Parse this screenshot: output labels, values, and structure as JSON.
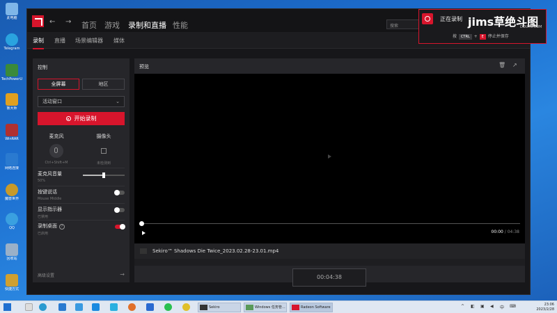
{
  "desktop": {
    "icons": [
      {
        "label": "此电脑",
        "color": "#7fb6e8"
      },
      {
        "label": "Telegram",
        "color": "#2aa3df"
      },
      {
        "label": "TechPowerUp GPU-Z",
        "color": "#3a8a3a"
      },
      {
        "label": "鲁大师",
        "color": "#e0a020"
      },
      {
        "label": "WinRAR",
        "color": "#b03030"
      },
      {
        "label": "网络连接",
        "color": "#2a7ad0"
      },
      {
        "label": "魔兽世界",
        "color": "#c89a2a"
      },
      {
        "label": "QQ",
        "color": "#3aa0e0"
      },
      {
        "label": "回收站",
        "color": "#9ab0c8"
      },
      {
        "label": "快捷方式",
        "color": "#d0a030"
      }
    ]
  },
  "app": {
    "top_tabs": [
      "首页",
      "游戏",
      "录制和直播",
      "性能"
    ],
    "active_top_tab": 2,
    "search_placeholder": "搜索",
    "sub_tabs": [
      "录制",
      "直播",
      "场景编辑器",
      "媒体"
    ],
    "active_sub_tab": 0
  },
  "control": {
    "header": "控制",
    "capture_modes": [
      "全屏幕",
      "地区"
    ],
    "active_mode": 0,
    "source": "活动窗口",
    "record_button": "开始录制",
    "mic": {
      "label": "麦克风",
      "hotkey": "Ctrl+Shift+M"
    },
    "camera": {
      "label": "摄像头",
      "status": "未检测到"
    },
    "mic_volume": {
      "label": "麦克风音量",
      "value": "50%",
      "level": 0.5
    },
    "push_to_talk": {
      "label": "按键说话",
      "sub": "Mouse Middle",
      "on": false
    },
    "show_indicator": {
      "label": "显示指示器",
      "sub": "已禁用",
      "on": false
    },
    "record_desktop": {
      "label": "录制桌面",
      "sub": "已启用",
      "info": "?",
      "on": true
    },
    "advanced": "高级设置"
  },
  "preview": {
    "header": "预览",
    "time_current": "00:00",
    "time_total": "/ 04:38",
    "filename": "Sekiro™ Shadows Die Twice_2023.02.28-23.01.mp4",
    "timer": "00:04:38"
  },
  "overlay": {
    "text": "正在录制",
    "watermark": "jims草绝斗图",
    "watermark_sub": "DOUYU.COM",
    "hint_prefix": "按",
    "key1": "CTRL",
    "plus": "+",
    "key2": "E",
    "hint_suffix": "停止并保存"
  },
  "taskbar": {
    "tasks": [
      "Sekiro",
      "Windows 任务管...",
      "Radeon Software"
    ],
    "time": "23:06",
    "date": "2023/2/28"
  }
}
